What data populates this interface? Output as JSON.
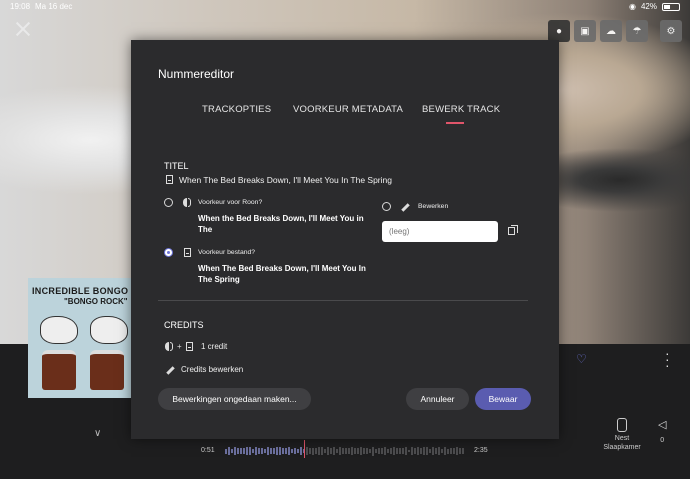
{
  "status_bar": {
    "time": "19:08",
    "date": "Ma 16 dec",
    "battery": "42%",
    "battery_level": 0.42
  },
  "modal": {
    "title": "Nummereditor",
    "tabs": [
      {
        "label": "TRACKOPTIES"
      },
      {
        "label": "VOORKEUR METADATA"
      },
      {
        "label": "BEWERK TRACK",
        "active": true
      }
    ],
    "titel_section": {
      "heading": "TITEL",
      "file_title": "When The Bed Breaks Down, I'll Meet You In The Spring",
      "roon_option_label": "Voorkeur voor Roon?",
      "roon_value": "When the Bed Breaks Down, I'll Meet You in The",
      "file_option_label": "Voorkeur bestand?",
      "file_value": "When The Bed Breaks Down, I'll Meet You In The Spring",
      "selected_option": "file",
      "edit_label": "Bewerken",
      "edit_placeholder": "(leeg)",
      "edit_value": ""
    },
    "credits_section": {
      "heading": "CREDITS",
      "plus": "+",
      "count_label": "1 credit",
      "edit_label": "Credits bewerken"
    },
    "buttons": {
      "undo": "Bewerkingen ongedaan maken...",
      "cancel": "Annuleer",
      "save": "Bewaar"
    }
  },
  "player": {
    "album_title": "INCREDIBLE BONGO BA",
    "album_subtitle": "\"BONGO ROCK\"",
    "track_title_fragment": "g",
    "elapsed": "0:51",
    "duration": "2:35",
    "progress": 0.33,
    "zone_name": "Nest\nSlaapkamer",
    "volume": "0"
  },
  "colors": {
    "accent": "#6d74d8",
    "tab_underline": "#e0556a",
    "save_button": "#5a5cb0",
    "modal_bg": "#2b2b2d"
  },
  "icons": [
    "close-icon",
    "profile-icon",
    "camera-icon",
    "cloud-icon",
    "storm-icon",
    "gear-icon",
    "heart-icon",
    "more-icon",
    "chevron-down-icon",
    "speaker-icon",
    "volume-icon",
    "document-icon",
    "roon-icon",
    "pencil-icon",
    "copy-icon"
  ]
}
